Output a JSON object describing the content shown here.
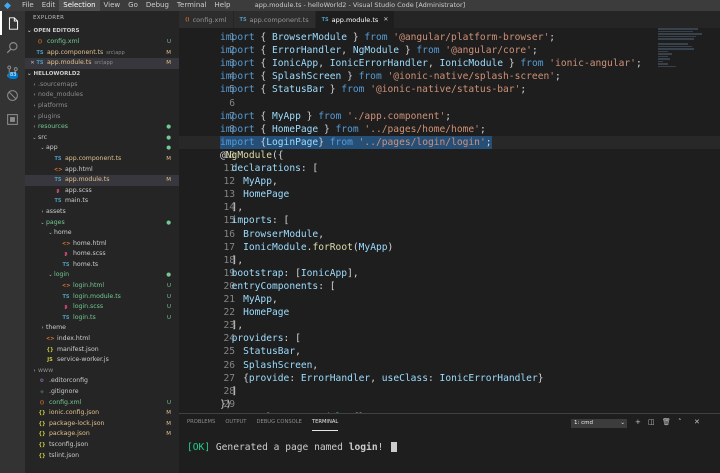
{
  "window": {
    "title": "app.module.ts - helloWorld2 - Visual Studio Code [Administrator]",
    "menu": [
      "File",
      "Edit",
      "Selection",
      "View",
      "Go",
      "Debug",
      "Terminal",
      "Help"
    ],
    "active_menu_index": 2
  },
  "activity": {
    "scm_badge": "83"
  },
  "sidebar": {
    "title": "EXPLORER",
    "open_editors_label": "OPEN EDITORS",
    "project_label": "HELLOWORLD2",
    "open_editors": [
      {
        "icon": "xml",
        "label": "config.xml",
        "desc": "",
        "status": "U",
        "close": false
      },
      {
        "icon": "ts",
        "label": "app.component.ts",
        "desc": "src\\app",
        "status": "M",
        "close": false
      },
      {
        "icon": "ts",
        "label": "app.module.ts",
        "desc": "src\\app",
        "status": "M",
        "close": true
      }
    ],
    "tree": [
      {
        "indent": 0,
        "twisty": "›",
        "icon": "",
        "label": ".sourcemaps",
        "cls": "dim",
        "status": ""
      },
      {
        "indent": 0,
        "twisty": "›",
        "icon": "",
        "label": "node_modules",
        "cls": "dim",
        "status": ""
      },
      {
        "indent": 0,
        "twisty": "›",
        "icon": "",
        "label": "platforms",
        "cls": "dim",
        "status": ""
      },
      {
        "indent": 0,
        "twisty": "›",
        "icon": "",
        "label": "plugins",
        "cls": "dim",
        "status": ""
      },
      {
        "indent": 0,
        "twisty": "›",
        "icon": "",
        "label": "resources",
        "cls": "new",
        "status": "dot"
      },
      {
        "indent": 0,
        "twisty": "⌄",
        "icon": "",
        "label": "src",
        "cls": "",
        "status": "dot"
      },
      {
        "indent": 1,
        "twisty": "⌄",
        "icon": "",
        "label": "app",
        "cls": "",
        "status": "dot"
      },
      {
        "indent": 2,
        "twisty": "",
        "icon": "ts",
        "label": "app.component.ts",
        "cls": "mod",
        "status": "M"
      },
      {
        "indent": 2,
        "twisty": "",
        "icon": "html",
        "label": "app.html",
        "cls": "",
        "status": ""
      },
      {
        "indent": 2,
        "twisty": "",
        "icon": "ts",
        "label": "app.module.ts",
        "cls": "mod",
        "status": "M",
        "selected": true
      },
      {
        "indent": 2,
        "twisty": "",
        "icon": "scss",
        "label": "app.scss",
        "cls": "",
        "status": ""
      },
      {
        "indent": 2,
        "twisty": "",
        "icon": "ts",
        "label": "main.ts",
        "cls": "",
        "status": ""
      },
      {
        "indent": 1,
        "twisty": "›",
        "icon": "",
        "label": "assets",
        "cls": "",
        "status": ""
      },
      {
        "indent": 1,
        "twisty": "⌄",
        "icon": "",
        "label": "pages",
        "cls": "new",
        "status": "dot"
      },
      {
        "indent": 2,
        "twisty": "⌄",
        "icon": "",
        "label": "home",
        "cls": "",
        "status": ""
      },
      {
        "indent": 3,
        "twisty": "",
        "icon": "html",
        "label": "home.html",
        "cls": "",
        "status": ""
      },
      {
        "indent": 3,
        "twisty": "",
        "icon": "scss",
        "label": "home.scss",
        "cls": "",
        "status": ""
      },
      {
        "indent": 3,
        "twisty": "",
        "icon": "ts",
        "label": "home.ts",
        "cls": "",
        "status": ""
      },
      {
        "indent": 2,
        "twisty": "⌄",
        "icon": "",
        "label": "login",
        "cls": "new",
        "status": "dot"
      },
      {
        "indent": 3,
        "twisty": "",
        "icon": "html",
        "label": "login.html",
        "cls": "new",
        "status": "U"
      },
      {
        "indent": 3,
        "twisty": "",
        "icon": "ts",
        "label": "login.module.ts",
        "cls": "new",
        "status": "U"
      },
      {
        "indent": 3,
        "twisty": "",
        "icon": "scss",
        "label": "login.scss",
        "cls": "new",
        "status": "U"
      },
      {
        "indent": 3,
        "twisty": "",
        "icon": "ts",
        "label": "login.ts",
        "cls": "new",
        "status": "U"
      },
      {
        "indent": 1,
        "twisty": "›",
        "icon": "",
        "label": "theme",
        "cls": "",
        "status": ""
      },
      {
        "indent": 1,
        "twisty": "",
        "icon": "html",
        "label": "index.html",
        "cls": "",
        "status": ""
      },
      {
        "indent": 1,
        "twisty": "",
        "icon": "json",
        "label": "manifest.json",
        "cls": "",
        "status": ""
      },
      {
        "indent": 1,
        "twisty": "",
        "icon": "js",
        "label": "service-worker.js",
        "cls": "",
        "status": ""
      },
      {
        "indent": 0,
        "twisty": "›",
        "icon": "",
        "label": "www",
        "cls": "dim",
        "status": ""
      },
      {
        "indent": 0,
        "twisty": "",
        "icon": "cfg",
        "label": ".editorconfig",
        "cls": "",
        "status": ""
      },
      {
        "indent": 0,
        "twisty": "",
        "icon": "git",
        "label": ".gitignore",
        "cls": "",
        "status": ""
      },
      {
        "indent": 0,
        "twisty": "",
        "icon": "xml",
        "label": "config.xml",
        "cls": "new",
        "status": "U"
      },
      {
        "indent": 0,
        "twisty": "",
        "icon": "json",
        "label": "ionic.config.json",
        "cls": "mod",
        "status": "M"
      },
      {
        "indent": 0,
        "twisty": "",
        "icon": "json",
        "label": "package-lock.json",
        "cls": "mod",
        "status": "M"
      },
      {
        "indent": 0,
        "twisty": "",
        "icon": "json",
        "label": "package.json",
        "cls": "mod",
        "status": "M"
      },
      {
        "indent": 0,
        "twisty": "",
        "icon": "json",
        "label": "tsconfig.json",
        "cls": "",
        "status": ""
      },
      {
        "indent": 0,
        "twisty": "",
        "icon": "json",
        "label": "tslint.json",
        "cls": "",
        "status": ""
      }
    ]
  },
  "tabs": [
    {
      "icon": "xml",
      "label": "config.xml",
      "active": false
    },
    {
      "icon": "ts",
      "label": "app.component.ts",
      "active": false
    },
    {
      "icon": "ts",
      "label": "app.module.ts",
      "active": true
    }
  ],
  "editor": {
    "current_line": 9,
    "lines": [
      [
        [
          "k",
          "import"
        ],
        [
          "p",
          " { "
        ],
        [
          "n",
          "BrowserModule"
        ],
        [
          "p",
          " } "
        ],
        [
          "k",
          "from"
        ],
        [
          "p",
          " "
        ],
        [
          "s",
          "'@angular/platform-browser'"
        ],
        [
          "p",
          ";"
        ]
      ],
      [
        [
          "k",
          "import"
        ],
        [
          "p",
          " { "
        ],
        [
          "n",
          "ErrorHandler"
        ],
        [
          "p",
          ", "
        ],
        [
          "n",
          "NgModule"
        ],
        [
          "p",
          " } "
        ],
        [
          "k",
          "from"
        ],
        [
          "p",
          " "
        ],
        [
          "s",
          "'@angular/core'"
        ],
        [
          "p",
          ";"
        ]
      ],
      [
        [
          "k",
          "import"
        ],
        [
          "p",
          " { "
        ],
        [
          "n",
          "IonicApp"
        ],
        [
          "p",
          ", "
        ],
        [
          "n",
          "IonicErrorHandler"
        ],
        [
          "p",
          ", "
        ],
        [
          "n",
          "IonicModule"
        ],
        [
          "p",
          " } "
        ],
        [
          "k",
          "from"
        ],
        [
          "p",
          " "
        ],
        [
          "s",
          "'ionic-angular'"
        ],
        [
          "p",
          ";"
        ]
      ],
      [
        [
          "k",
          "import"
        ],
        [
          "p",
          " { "
        ],
        [
          "n",
          "SplashScreen"
        ],
        [
          "p",
          " } "
        ],
        [
          "k",
          "from"
        ],
        [
          "p",
          " "
        ],
        [
          "s",
          "'@ionic-native/splash-screen'"
        ],
        [
          "p",
          ";"
        ]
      ],
      [
        [
          "k",
          "import"
        ],
        [
          "p",
          " { "
        ],
        [
          "n",
          "StatusBar"
        ],
        [
          "p",
          " } "
        ],
        [
          "k",
          "from"
        ],
        [
          "p",
          " "
        ],
        [
          "s",
          "'@ionic-native/status-bar'"
        ],
        [
          "p",
          ";"
        ]
      ],
      [],
      [
        [
          "k",
          "import"
        ],
        [
          "p",
          " { "
        ],
        [
          "n",
          "MyApp"
        ],
        [
          "p",
          " } "
        ],
        [
          "k",
          "from"
        ],
        [
          "p",
          " "
        ],
        [
          "s",
          "'./app.component'"
        ],
        [
          "p",
          ";"
        ]
      ],
      [
        [
          "k",
          "import"
        ],
        [
          "p",
          " { "
        ],
        [
          "n",
          "HomePage"
        ],
        [
          "p",
          " } "
        ],
        [
          "k",
          "from"
        ],
        [
          "p",
          " "
        ],
        [
          "s",
          "'../pages/home/home'"
        ],
        [
          "p",
          ";"
        ]
      ],
      [
        [
          "k",
          "import"
        ],
        [
          "p",
          " {"
        ],
        [
          "n",
          "LoginPage"
        ],
        [
          "p",
          "} "
        ],
        [
          "k",
          "from"
        ],
        [
          "p",
          " "
        ],
        [
          "s",
          "'../pages/login/login'"
        ],
        [
          "p",
          ";"
        ]
      ],
      [
        [
          "p",
          "@"
        ],
        [
          "f",
          "NgModule"
        ],
        [
          "p",
          "({"
        ]
      ],
      [
        [
          "p",
          "  "
        ],
        [
          "n",
          "declarations"
        ],
        [
          "p",
          ": ["
        ]
      ],
      [
        [
          "p",
          "    "
        ],
        [
          "n",
          "MyApp"
        ],
        [
          "p",
          ","
        ]
      ],
      [
        [
          "p",
          "    "
        ],
        [
          "n",
          "HomePage"
        ]
      ],
      [
        [
          "p",
          "  ],"
        ]
      ],
      [
        [
          "p",
          "  "
        ],
        [
          "n",
          "imports"
        ],
        [
          "p",
          ": ["
        ]
      ],
      [
        [
          "p",
          "    "
        ],
        [
          "n",
          "BrowserModule"
        ],
        [
          "p",
          ","
        ]
      ],
      [
        [
          "p",
          "    "
        ],
        [
          "n",
          "IonicModule"
        ],
        [
          "p",
          "."
        ],
        [
          "f",
          "forRoot"
        ],
        [
          "p",
          "("
        ],
        [
          "n",
          "MyApp"
        ],
        [
          "p",
          ")"
        ]
      ],
      [
        [
          "p",
          "  ],"
        ]
      ],
      [
        [
          "p",
          "  "
        ],
        [
          "n",
          "bootstrap"
        ],
        [
          "p",
          ": ["
        ],
        [
          "n",
          "IonicApp"
        ],
        [
          "p",
          "],"
        ]
      ],
      [
        [
          "p",
          "  "
        ],
        [
          "n",
          "entryComponents"
        ],
        [
          "p",
          ": ["
        ]
      ],
      [
        [
          "p",
          "    "
        ],
        [
          "n",
          "MyApp"
        ],
        [
          "p",
          ","
        ]
      ],
      [
        [
          "p",
          "    "
        ],
        [
          "n",
          "HomePage"
        ]
      ],
      [
        [
          "p",
          "  ],"
        ]
      ],
      [
        [
          "p",
          "  "
        ],
        [
          "n",
          "providers"
        ],
        [
          "p",
          ": ["
        ]
      ],
      [
        [
          "p",
          "    "
        ],
        [
          "n",
          "StatusBar"
        ],
        [
          "p",
          ","
        ]
      ],
      [
        [
          "p",
          "    "
        ],
        [
          "n",
          "SplashScreen"
        ],
        [
          "p",
          ","
        ]
      ],
      [
        [
          "p",
          "    {"
        ],
        [
          "n",
          "provide"
        ],
        [
          "p",
          ": "
        ],
        [
          "n",
          "ErrorHandler"
        ],
        [
          "p",
          ", "
        ],
        [
          "n",
          "useClass"
        ],
        [
          "p",
          ": "
        ],
        [
          "n",
          "IonicErrorHandler"
        ],
        [
          "p",
          "}"
        ]
      ],
      [
        [
          "p",
          "  ]"
        ]
      ],
      [
        [
          "p",
          "})"
        ]
      ],
      [
        [
          "k",
          "export"
        ],
        [
          "p",
          " "
        ],
        [
          "k",
          "class"
        ],
        [
          "p",
          " "
        ],
        [
          "c",
          "AppModule"
        ],
        [
          "p",
          " {}"
        ]
      ]
    ]
  },
  "panel": {
    "tabs": [
      "PROBLEMS",
      "OUTPUT",
      "DEBUG CONSOLE",
      "TERMINAL"
    ],
    "active_tab_index": 3,
    "terminal_select": "1: cmd",
    "terminal_ok": "[OK]",
    "terminal_text": " Generated a page named ",
    "terminal_name": "login",
    "terminal_end": "!"
  }
}
